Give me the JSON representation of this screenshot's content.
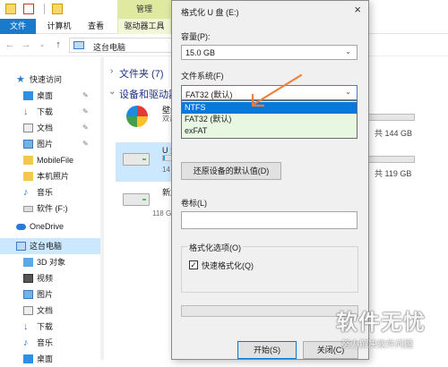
{
  "explorer": {
    "manage_tab": "管理",
    "ribbon_tabs": {
      "file": "文件",
      "computer": "计算机",
      "view": "查看",
      "drive_tools": "驱动器工具"
    },
    "address": "这台电脑",
    "nav": {
      "quick_access": "快速访问",
      "desktop": "桌面",
      "downloads": "下载",
      "documents": "文档",
      "pictures": "图片",
      "mobilefile": "MobileFile",
      "camera_roll": "本机照片",
      "music": "音乐",
      "drive_f": "软件 (F:)",
      "onedrive": "OneDrive",
      "this_pc": "这台电脑",
      "objects3d": "3D 对象",
      "videos": "视频",
      "pictures2": "图片",
      "documents2": "文档",
      "downloads2": "下载",
      "music2": "音乐",
      "desktop2": "桌面"
    },
    "content": {
      "folders_header": "文件夹 (7)",
      "devices_header": "设备和驱动器",
      "drives": [
        {
          "name": "壁纸",
          "sub": "双击"
        },
        {
          "name": "U 盘",
          "sub": "14",
          "fill": 0.1
        },
        {
          "name": "新加",
          "sub": "118 G"
        }
      ],
      "right_sizes": [
        "共 144 GB",
        "共 119 GB"
      ]
    }
  },
  "dialog": {
    "title": "格式化 U 盘 (E:)",
    "close_glyph": "×",
    "capacity_label": "容量(P):",
    "capacity_value": "15.0 GB",
    "filesystem_label": "文件系统(F)",
    "filesystem_value": "FAT32 (默认)",
    "filesystem_options": [
      "NTFS",
      "FAT32 (默认)",
      "exFAT"
    ],
    "restore_button": "还原设备的默认值(D)",
    "volume_label": "卷标(L)",
    "volume_value": "",
    "format_options_label": "格式化选项(O)",
    "quick_format_label": "快速格式化(Q)",
    "quick_format_checked": true,
    "start_button": "开始(S)",
    "close_button": "关闭(C)",
    "dropdown_arrow": "⌄"
  },
  "watermark": {
    "main": "软件无忧",
    "sub": "努力解决软件问题"
  },
  "colors": {
    "accent": "#0a78d7",
    "file_tab": "#1979ca",
    "annotation": "#f07d3a"
  }
}
